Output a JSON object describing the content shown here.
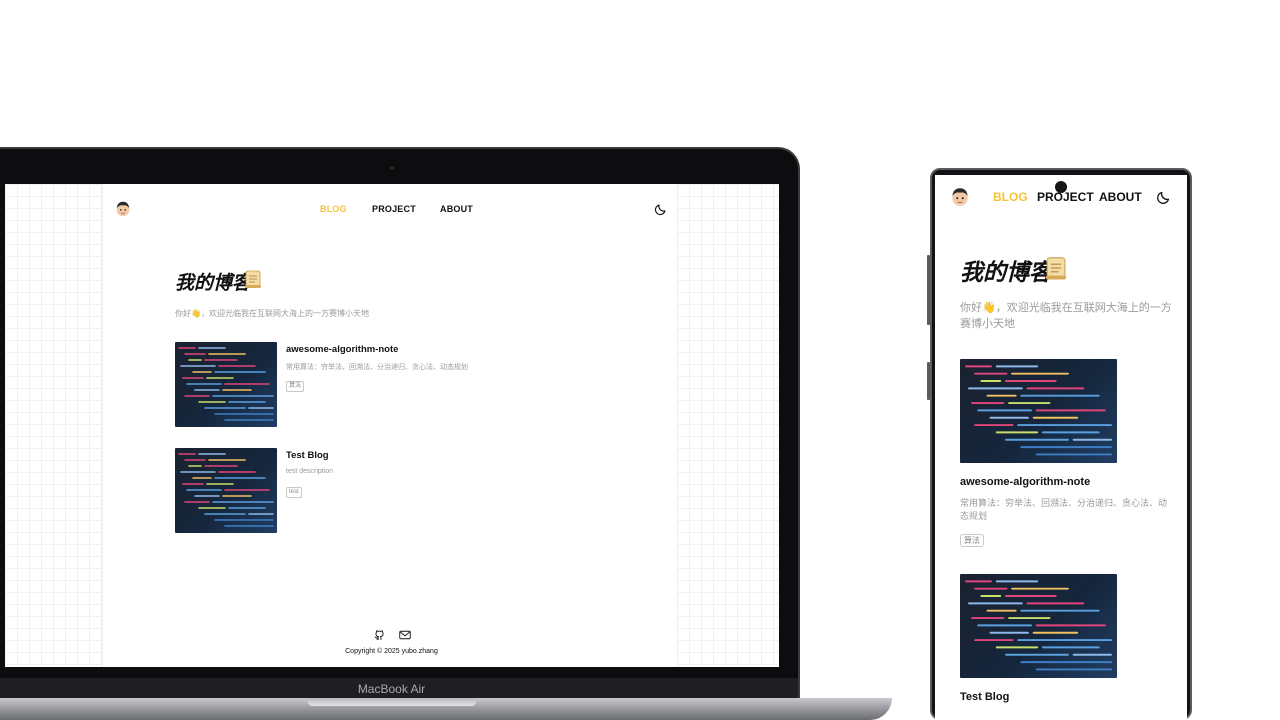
{
  "laptop": {
    "label": "MacBook Air",
    "site": {
      "nav": {
        "blog": "BLOG",
        "project": "PROJECT",
        "about": "ABOUT"
      },
      "page_title": "我的博客",
      "intro": "你好👋，欢迎光临我在互联网大海上的一方赛博小天地",
      "posts": [
        {
          "title": "awesome-algorithm-note",
          "description": "常用算法：穷举法、回溯法、分治递归、贪心法、动态规划",
          "tag": "算法"
        },
        {
          "title": "Test Blog",
          "description": "test description",
          "tag": "test"
        }
      ],
      "footer": {
        "copyright": "Copyright © 2025 yubo.zhang"
      }
    }
  },
  "phone": {
    "site": {
      "nav": {
        "blog": "BLOG",
        "project": "PROJECT",
        "about": "ABOUT"
      },
      "page_title": "我的博客",
      "intro": "你好👋，欢迎光临我在互联网大海上的一方赛博小天地",
      "posts": [
        {
          "title": "awesome-algorithm-note",
          "description": "常用算法：穷举法、回溯法、分治递归、贪心法、动态规划",
          "tag": "算法"
        },
        {
          "title": "Test Blog"
        }
      ]
    }
  },
  "icons": {
    "avatar": "avatar-memoji",
    "theme": "moon-icon",
    "title_decoration": "scroll-icon",
    "footer": [
      "github-icon",
      "mail-icon"
    ]
  },
  "colors": {
    "accent": "#f5c23a",
    "text": "#111111",
    "muted": "#9a9a9a"
  }
}
